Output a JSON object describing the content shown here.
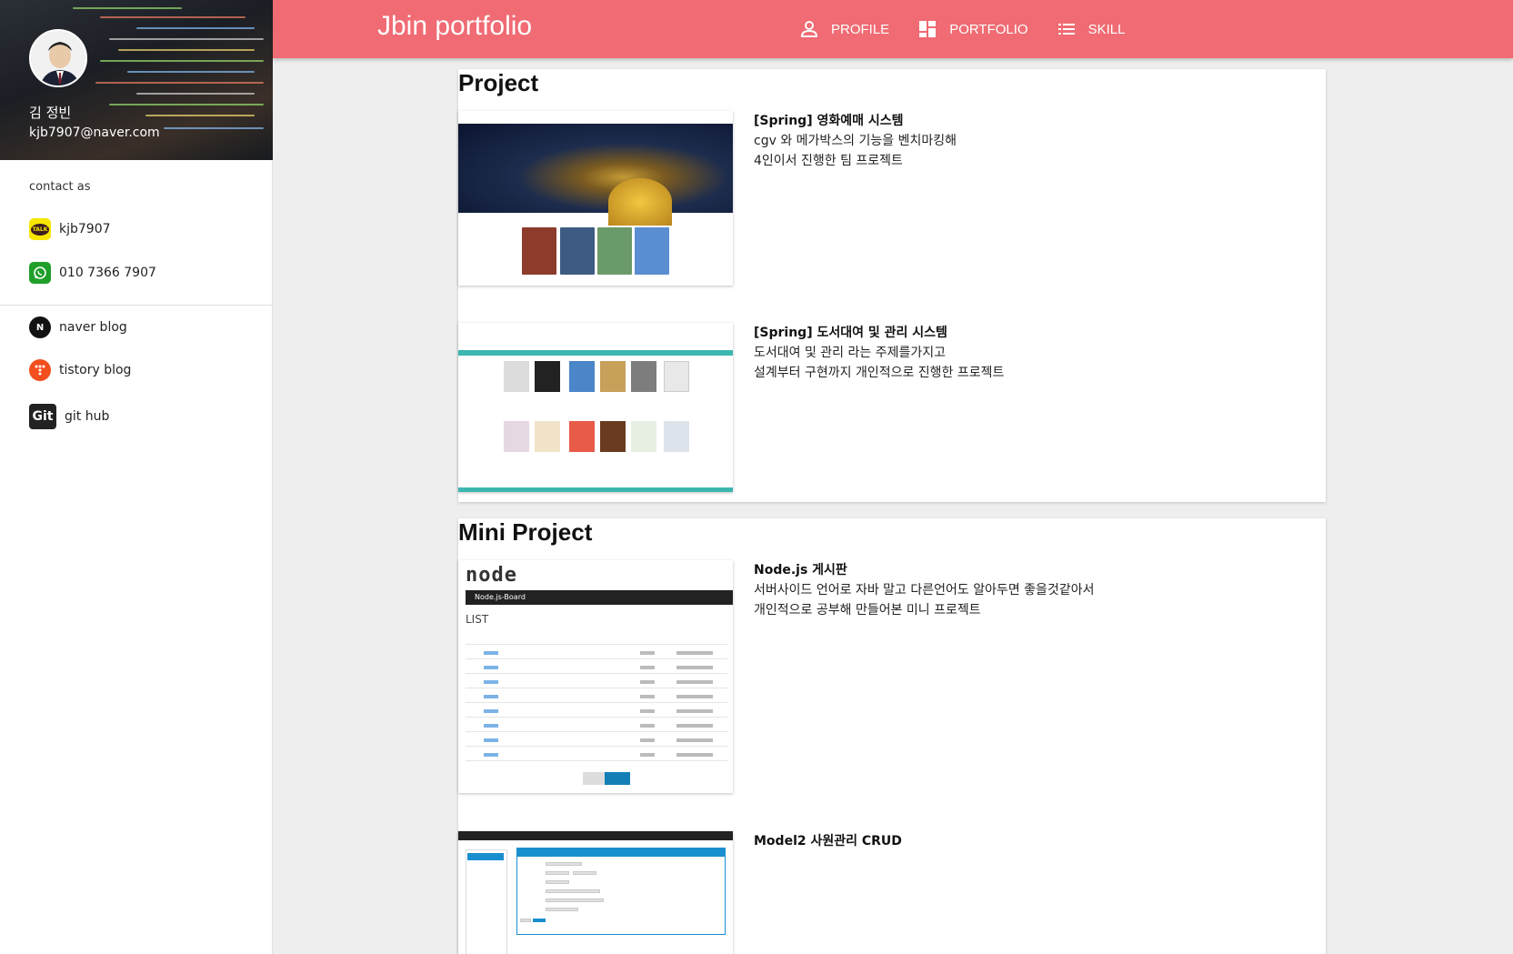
{
  "sidebar": {
    "name": "김 정빈",
    "email": "kjb7907@naver.com",
    "contact_title": "contact as",
    "contacts": [
      {
        "icon": "kakaotalk-icon",
        "label": "kjb7907"
      },
      {
        "icon": "whatsapp-icon",
        "label": "010 7366 7907"
      }
    ],
    "links": [
      {
        "icon": "naver-icon",
        "label": "naver blog"
      },
      {
        "icon": "tistory-icon",
        "label": "tistory blog"
      },
      {
        "icon": "github-icon",
        "label": "git hub"
      }
    ]
  },
  "header": {
    "title": "Jbin portfolio",
    "nav": [
      {
        "icon": "person-icon",
        "label": "PROFILE"
      },
      {
        "icon": "dashboard-icon",
        "label": "PORTFOLIO"
      },
      {
        "icon": "list-icon",
        "label": "SKILL"
      }
    ],
    "color": "#f06b73"
  },
  "sections": [
    {
      "title": "Project",
      "items": [
        {
          "title": "[Spring] 영화예매 시스템",
          "lines": [
            "cgv 와 메가박스의 기능을 벤치마킹해",
            "4인이서 진행한 팀 프로젝트"
          ]
        },
        {
          "title": "[Spring] 도서대여 및 관리 시스템",
          "lines": [
            "도서대여 및 관리 라는 주제를가지고",
            "설계부터 구현까지 개인적으로 진행한 프로젝트"
          ]
        }
      ]
    },
    {
      "title": "Mini Project",
      "items": [
        {
          "title": "Node.js 게시판",
          "lines": [
            "서버사이드 언어로 자바 말고 다른언어도 알아두면 좋을것같아서",
            "개인적으로 공부해 만들어본 미니 프로젝트"
          ]
        },
        {
          "title": "Model2 사원관리 CRUD",
          "lines": []
        }
      ]
    }
  ],
  "thumbnails": {
    "node_logo": "node",
    "node_bar": "Node.js-Board",
    "node_list": "LIST"
  }
}
